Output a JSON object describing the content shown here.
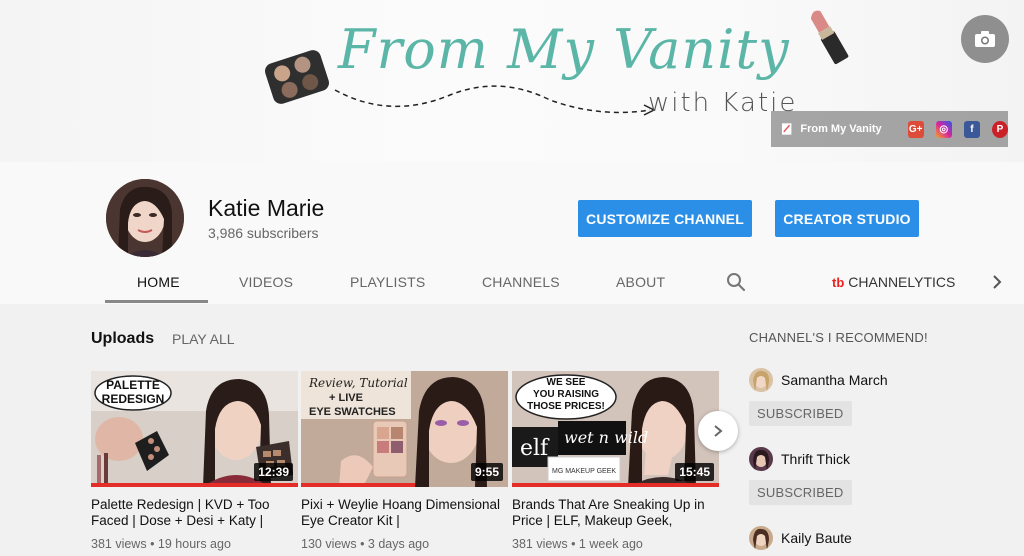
{
  "banner": {
    "logo_title": "From My Vanity",
    "logo_subtitle": "with Katie",
    "social_label": "From My Vanity",
    "social_icons": [
      "google-plus-icon",
      "instagram-icon",
      "facebook-icon",
      "pinterest-icon"
    ],
    "social_glyphs": {
      "google_plus": "G+",
      "instagram": "◎",
      "facebook": "f",
      "pinterest": "P"
    }
  },
  "channel": {
    "name": "Katie Marie",
    "subscribers": "3,986 subscribers",
    "customize_label": "CUSTOMIZE CHANNEL",
    "studio_label": "CREATOR STUDIO"
  },
  "tabs": [
    {
      "label": "HOME",
      "active": true
    },
    {
      "label": "VIDEOS",
      "active": false
    },
    {
      "label": "PLAYLISTS",
      "active": false
    },
    {
      "label": "CHANNELS",
      "active": false
    },
    {
      "label": "ABOUT",
      "active": false
    }
  ],
  "channelytics": {
    "logo": "tb",
    "label": "CHANNELYTICS"
  },
  "uploads": {
    "title": "Uploads",
    "play_all": "PLAY ALL",
    "videos": [
      {
        "thumb_text": "PALETTE REDESIGN",
        "duration": "12:39",
        "title": "Palette Redesign | KVD + Too Faced | Dose + Desi + Katy |",
        "views": "381 views",
        "age": "19 hours ago",
        "progress": 1.0
      },
      {
        "thumb_text": "Review, Tutorial + LIVE EYE SWATCHES",
        "duration": "9:55",
        "title": "Pixi + Weylie Hoang Dimensional Eye Creator Kit |",
        "views": "130 views",
        "age": "3 days ago",
        "progress": 0.55
      },
      {
        "thumb_text": "WE SEE YOU RAISING THOSE PRICES!",
        "duration": "15:45",
        "title": "Brands That Are Sneaking Up in Price | ELF, Makeup Geek,",
        "views": "381 views",
        "age": "1 week ago",
        "progress": 1.0
      }
    ]
  },
  "recommended": {
    "title": "CHANNEL'S I RECOMMEND!",
    "channels": [
      {
        "name": "Samantha March",
        "button": "SUBSCRIBED"
      },
      {
        "name": "Thrift Thick",
        "button": "SUBSCRIBED"
      },
      {
        "name": "Kaily Baute",
        "button": ""
      }
    ]
  },
  "colors": {
    "accent_blue": "#2b8fe8",
    "logo_teal": "#5bb6a8",
    "progress_red": "#e52d27"
  }
}
